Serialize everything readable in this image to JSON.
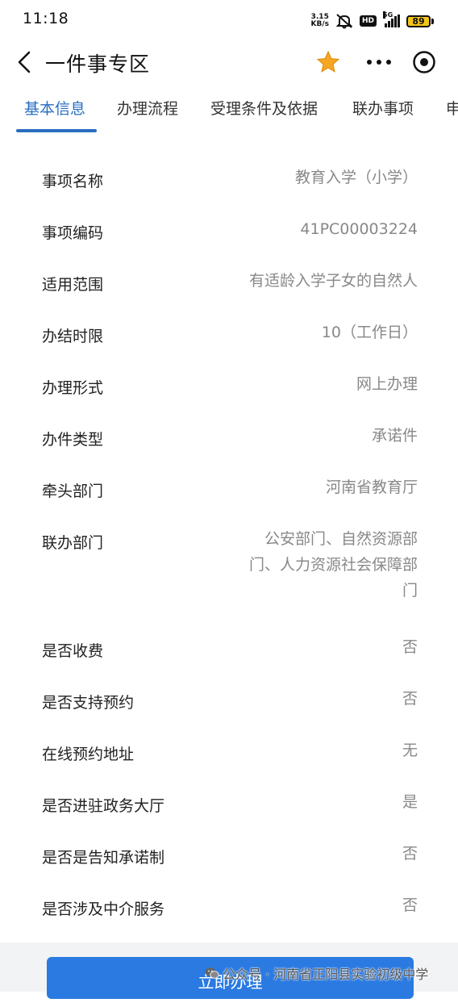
{
  "status_bar": {
    "time": "11:18",
    "net_speed_value": "3.15",
    "net_speed_unit": "KB/s",
    "hd": "HD",
    "network": "5G",
    "battery": "89"
  },
  "header": {
    "title": "一件事专区"
  },
  "tabs": [
    {
      "label": "基本信息",
      "active": true
    },
    {
      "label": "办理流程",
      "active": false
    },
    {
      "label": "受理条件及依据",
      "active": false
    },
    {
      "label": "联办事项",
      "active": false
    },
    {
      "label": "申",
      "active": false
    }
  ],
  "info": [
    {
      "label": "事项名称",
      "value": "教育入学（小学）"
    },
    {
      "label": "事项编码",
      "value": "41PC00003224"
    },
    {
      "label": "适用范围",
      "value": "有适龄入学子女的自然人"
    },
    {
      "label": "办结时限",
      "value": "10（工作日）"
    },
    {
      "label": "办理形式",
      "value": "网上办理"
    },
    {
      "label": "办件类型",
      "value": "承诺件"
    },
    {
      "label": "牵头部门",
      "value": "河南省教育厅"
    },
    {
      "label": "联办部门",
      "value_lines": [
        "公安部门、自然资源部",
        "门、人力资源社会保障部",
        "门"
      ]
    },
    {
      "label": "是否收费",
      "value": "否"
    },
    {
      "label": "是否支持预约",
      "value": "否"
    },
    {
      "label": "在线预约地址",
      "value": "无"
    },
    {
      "label": "是否进驻政务大厅",
      "value": "是"
    },
    {
      "label": "是否是告知承诺制",
      "value": "否"
    },
    {
      "label": "是否涉及中介服务",
      "value": "否"
    }
  ],
  "bottom": {
    "apply_label": "立即办理",
    "watermark": "公众号 · 河南省正阳县实验初级中学"
  },
  "colors": {
    "accent": "#2a6ec0",
    "button": "#2a7ae2",
    "star": "#f5a623",
    "battery": "#f5c518"
  }
}
